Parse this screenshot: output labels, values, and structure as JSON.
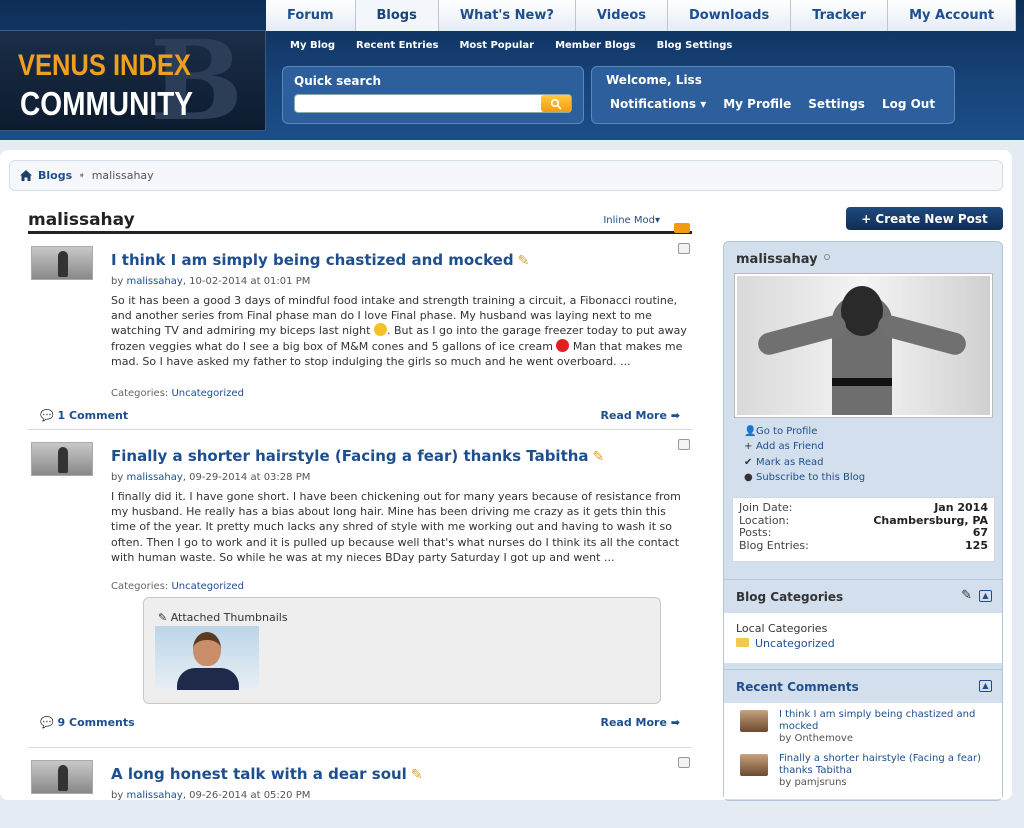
{
  "nav": {
    "tabs": [
      "Forum",
      "Blogs",
      "What's New?",
      "Videos",
      "Downloads",
      "Tracker",
      "My Account"
    ],
    "subnav": [
      "My Blog",
      "Recent Entries",
      "Most Popular",
      "Member Blogs",
      "Blog Settings"
    ]
  },
  "logo": {
    "line1": "VENUS INDEX",
    "line2": "COMMUNITY"
  },
  "search": {
    "label": "Quick search",
    "placeholder": ""
  },
  "user": {
    "welcome": "Welcome, Liss",
    "links": [
      "Notifications ▾",
      "My Profile",
      "Settings",
      "Log Out"
    ]
  },
  "breadcrumb": {
    "home": "Blogs",
    "current": "malissahay"
  },
  "blog": {
    "title": "malissahay",
    "inline_mod": "Inline Mod▾"
  },
  "entries": [
    {
      "title": "I think I am simply being chastized and mocked",
      "by": "by ",
      "author": "malissahay",
      "date": ", 10-02-2014 at 01:01 PM",
      "body1": "So it has been a good 3 days of mindful food intake and strength training a circuit, a Fibonacci routine, and another series from Final phase man do I love Final phase. My husband was laying next to me watching TV and admiring my biceps last night ",
      "body2": ". But as I go into the garage freezer today to put away frozen veggies what do I see a big box of M&M cones and 5 gallons of ice cream ",
      "body3": " Man that makes me mad. So I have asked my father to stop indulging the girls so much and he went overboard. ...",
      "categories_label": "Categories: ",
      "category": "Uncategorized",
      "comments": "1 Comment",
      "read_more": "Read More"
    },
    {
      "title": "Finally a shorter hairstyle (Facing a fear) thanks Tabitha",
      "by": "by ",
      "author": "malissahay",
      "date": ", 09-29-2014 at 03:28 PM",
      "body": "I finally did it. I have gone short. I have been chickening out for many years because of resistance from my husband. He really has a bias about long hair. Mine has been driving me crazy as it gets thin this time of the year. It pretty much lacks any shred of style with me working out and having to wash it so often. Then I go to work and it is pulled up because well that's what nurses do I think its all the contact with human waste. So while he was at my nieces BDay party Saturday I got up and went ...",
      "categories_label": "Categories: ",
      "category": "Uncategorized",
      "attached_label": "Attached Thumbnails",
      "comments": "9 Comments",
      "read_more": "Read More"
    },
    {
      "title": "A long honest talk with a dear soul",
      "by": "by ",
      "author": "malissahay",
      "date": ", 09-26-2014 at 05:20 PM"
    }
  ],
  "sidebar": {
    "create_button": "+ Create New Post",
    "username": "malissahay",
    "actions": [
      "Go to Profile",
      "Add as Friend",
      "Mark as Read",
      "Subscribe to this Blog"
    ],
    "stats": [
      {
        "label": "Join Date:",
        "value": "Jan 2014"
      },
      {
        "label": "Location:",
        "value": "Chambersburg, PA"
      },
      {
        "label": "Posts:",
        "value": "67"
      },
      {
        "label": "Blog Entries:",
        "value": "125"
      }
    ],
    "categories": {
      "title": "Blog Categories",
      "local": "Local Categories",
      "item": "Uncategorized"
    },
    "recent_comments": {
      "title": "Recent Comments",
      "items": [
        {
          "title": "I think I am simply being chastized and mocked",
          "by": "by Onthemove"
        },
        {
          "title": "Finally a shorter hairstyle (Facing a fear) thanks Tabitha",
          "by": "by pamjsruns"
        }
      ]
    }
  }
}
